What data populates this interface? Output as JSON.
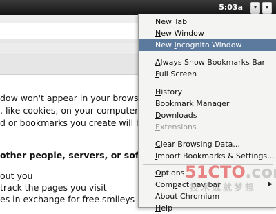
{
  "panel": {
    "time": "5:03a"
  },
  "page": {
    "lines": [
      "dow won't appear in your browser",
      ", like cookies, on your computer af",
      "d or bookmarks you create will be",
      "other people, servers, or softwa",
      "out you",
      " track the pages you visit",
      "es in exchange for free smileys"
    ]
  },
  "menu": {
    "items": [
      {
        "label": "New Tab",
        "key": "N"
      },
      {
        "label": "New Window",
        "key": "N"
      },
      {
        "label": "New Incognito Window",
        "key": "I",
        "highlighted": true
      },
      {
        "label": "Always Show Bookmarks Bar",
        "key": "A"
      },
      {
        "label": "Full Screen",
        "key": "F"
      },
      {
        "label": "History",
        "key": "H"
      },
      {
        "label": "Bookmark Manager",
        "key": "B"
      },
      {
        "label": "Downloads",
        "key": "D"
      },
      {
        "label": "Extensions",
        "key": "E",
        "disabled": true
      },
      {
        "label": "Clear Browsing Data...",
        "key": "C"
      },
      {
        "label": "Import Bookmarks & Settings...",
        "key": "I"
      },
      {
        "label": "Options",
        "key": "O"
      },
      {
        "label": "Compact nav bar",
        "key": "p"
      },
      {
        "label": "About Chromium",
        "key": "C"
      },
      {
        "label": "Help",
        "key": "H"
      }
    ]
  },
  "watermark": {
    "brand_red": "51CTO",
    "brand_grey": ".com",
    "slogan": "技术成就梦想"
  }
}
